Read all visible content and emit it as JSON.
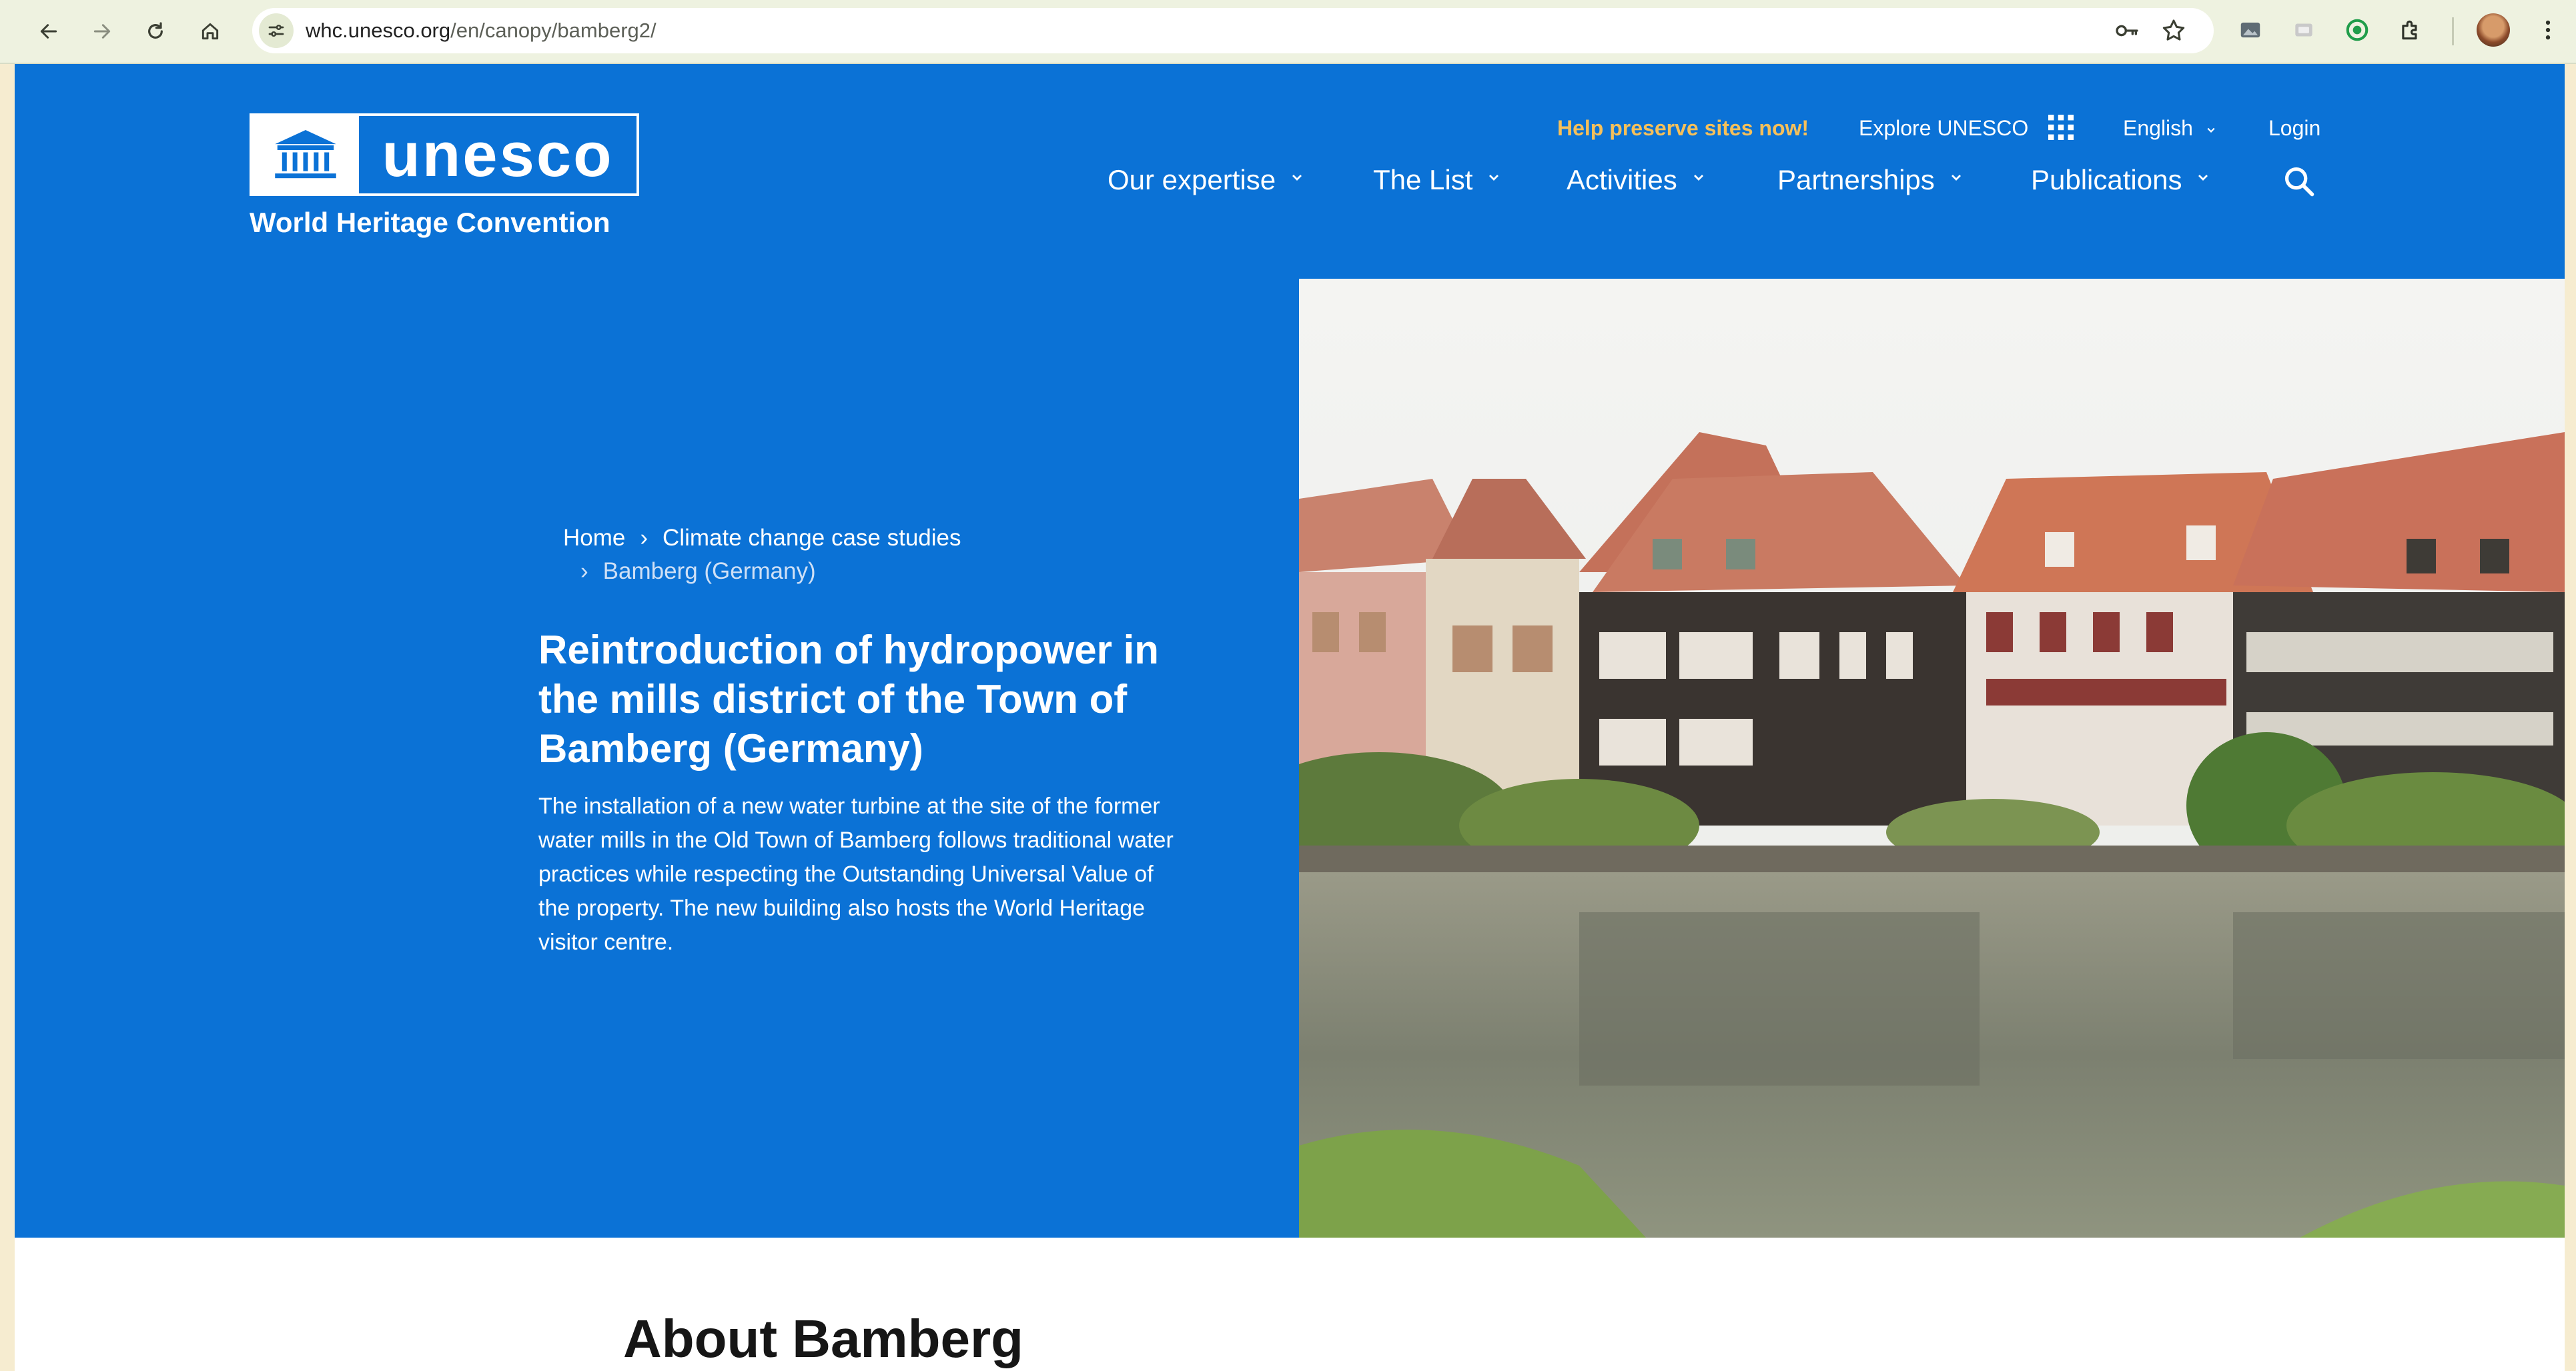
{
  "browser": {
    "url_host": "whc.unesco.org",
    "url_path": "/en/canopy/bamberg2/",
    "icons": [
      "back-icon",
      "forward-icon",
      "reload-icon",
      "home-icon",
      "site-settings-icon",
      "password-key-icon",
      "bookmark-star-icon",
      "extension-icons",
      "puzzle-extensions-icon",
      "profile-avatar",
      "menu-dots-icon"
    ]
  },
  "header": {
    "logo_word": "unesco",
    "logo_subtitle": "World Heritage Convention",
    "utility": {
      "help": "Help preserve sites now!",
      "explore": "Explore UNESCO",
      "language": "English",
      "login": "Login"
    },
    "nav": [
      "Our expertise",
      "The List",
      "Activities",
      "Partnerships",
      "Publications"
    ]
  },
  "hero": {
    "breadcrumb": {
      "home": "Home",
      "section": "Climate change case studies",
      "current": "Bamberg (Germany)"
    },
    "title": "Reintroduction of hydropower in the mills district of the Town of Bamberg (Germany)",
    "description": "The installation of a new water turbine at the site of the former water mills in the Old Town of Bamberg follows traditional water practices while respecting the Outstanding Universal Value of the property. The new building also hosts the World Heritage visitor centre."
  },
  "about": {
    "title": "About Bamberg"
  },
  "colors": {
    "unesco_blue": "#0b72d6",
    "help_text": "#f6c05a",
    "chrome_bg": "#eef2e0"
  }
}
